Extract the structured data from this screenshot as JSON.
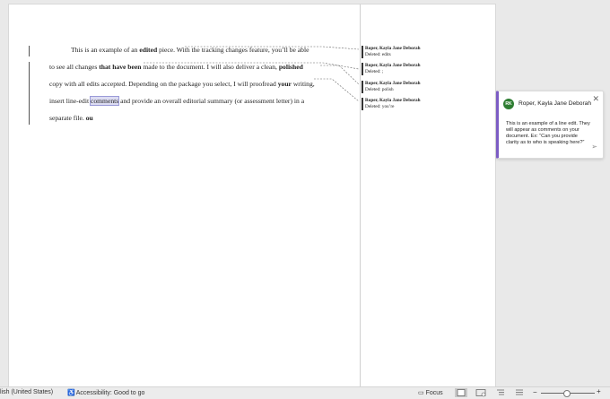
{
  "document": {
    "lines": [
      {
        "parts": [
          {
            "t": "This is an example of an "
          },
          {
            "t": "edited",
            "b": true
          },
          {
            "t": " piece. With the tracking changes feature, you’ll be able"
          }
        ]
      },
      {
        "parts": [
          {
            "t": "to see all changes "
          },
          {
            "t": "that have been",
            "b": true
          },
          {
            "t": " made to the document. I will also deliver a clean, "
          },
          {
            "t": "polished",
            "b": true
          }
        ]
      },
      {
        "parts": [
          {
            "t": "copy with all edits accepted. Depending on the package you select, I will proofread "
          },
          {
            "t": "your",
            "b": true
          },
          {
            "t": " writing,"
          }
        ]
      },
      {
        "parts": [
          {
            "t": "insert line-edit "
          },
          {
            "t": "comments",
            "hl": true
          },
          {
            "t": " and provide an overall editorial summary (or assessment letter) in a"
          }
        ]
      },
      {
        "parts": [
          {
            "t": "separate file.  "
          },
          {
            "t": "ou",
            "b": true
          }
        ]
      }
    ]
  },
  "balloons": [
    {
      "author": "Roper, Kayla Jane Deborah",
      "text": "Deleted: edits"
    },
    {
      "author": "Roper, Kayla Jane Deborah",
      "text": "Deleted: ;"
    },
    {
      "author": "Roper, Kayla Jane Deborah",
      "text": "Deleted: polish"
    },
    {
      "author": "Roper, Kayla Jane Deborah",
      "text": "Deleted: you’re"
    }
  ],
  "comment_card": {
    "initials": "RK",
    "author": "Roper, Kayla Jane Deborah",
    "text": "This is an example of a line edit. They will appear as comments on your document. Ex: “Can you provide clarity as to who is speaking here?”",
    "close_icon": "close-icon",
    "send_icon": "send-icon",
    "accent": "#7b5cc4"
  },
  "status_bar": {
    "language": "lish (United States)",
    "accessibility": "Accessibility: Good to go",
    "focus": "Focus"
  }
}
